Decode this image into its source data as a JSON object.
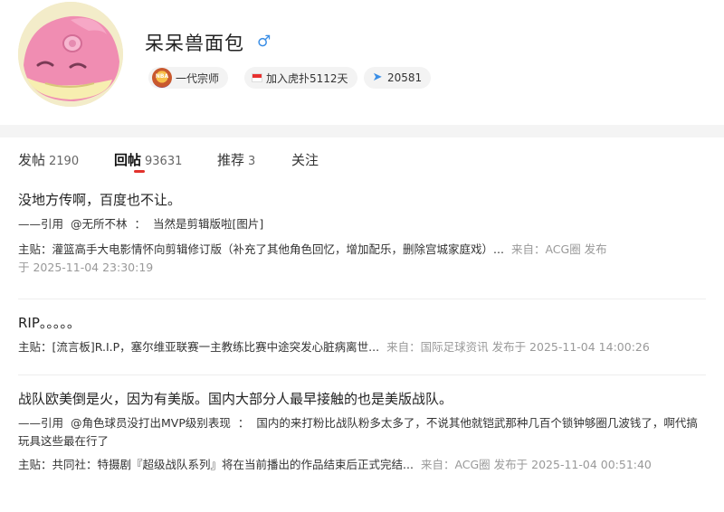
{
  "profile": {
    "username": "呆呆兽面包",
    "gender_symbol": "♂",
    "rank_label": "一代宗师",
    "rank_icon_text": "NBA",
    "join_label": "加入虎扑5112天",
    "points": "20581",
    "icons": {
      "avatar": "avatar-slowpoke",
      "rank": "rank-badge-icon",
      "flag": "flag-icon",
      "points": "points-icon"
    }
  },
  "tabs": [
    {
      "label": "发帖",
      "count": "2190"
    },
    {
      "label": "回帖",
      "count": "93631"
    },
    {
      "label": "推荐",
      "count": "3"
    },
    {
      "label": "关注",
      "count": ""
    }
  ],
  "posts": [
    {
      "text": "没地方传啊，百度也不让。",
      "quote_prefix": "——引用",
      "quote_user": "@无所不林",
      "quote_sep": "：",
      "quote_text": "当然是剪辑版啦[图片]",
      "meta_label": "主贴：",
      "meta_title": "灌篮高手大电影情怀向剪辑修订版（补充了其他角色回忆，增加配乐，删除宫城家庭戏）...",
      "meta_source": "来自：ACG圈 发布",
      "meta_time": "于 2025-11-04 23:30:19"
    },
    {
      "text": "RIP。。。。。",
      "meta_label": "主贴：",
      "meta_title": "[流言板]R.I.P，塞尔维亚联赛一主教练比赛中途突发心脏病离世...",
      "meta_source": "来自：国际足球资讯 发布于 2025-11-04 14:00:26"
    },
    {
      "text": "战队欧美倒是火，因为有美版。国内大部分人最早接触的也是美版战队。",
      "quote_prefix": "——引用",
      "quote_user": "@角色球员没打出MVP级别表现",
      "quote_sep": "：",
      "quote_text": "国内的来打粉比战队粉多太多了，不说其他就铠武那种几百个锁钟够圈几波钱了，啊代搞玩具这些最在行了",
      "meta_label": "主贴：",
      "meta_title": "共同社：特摄剧『超级战队系列』将在当前播出的作品结束后正式完结...",
      "meta_source": "来自：ACG圈 发布于 2025-11-04 00:51:40"
    }
  ]
}
